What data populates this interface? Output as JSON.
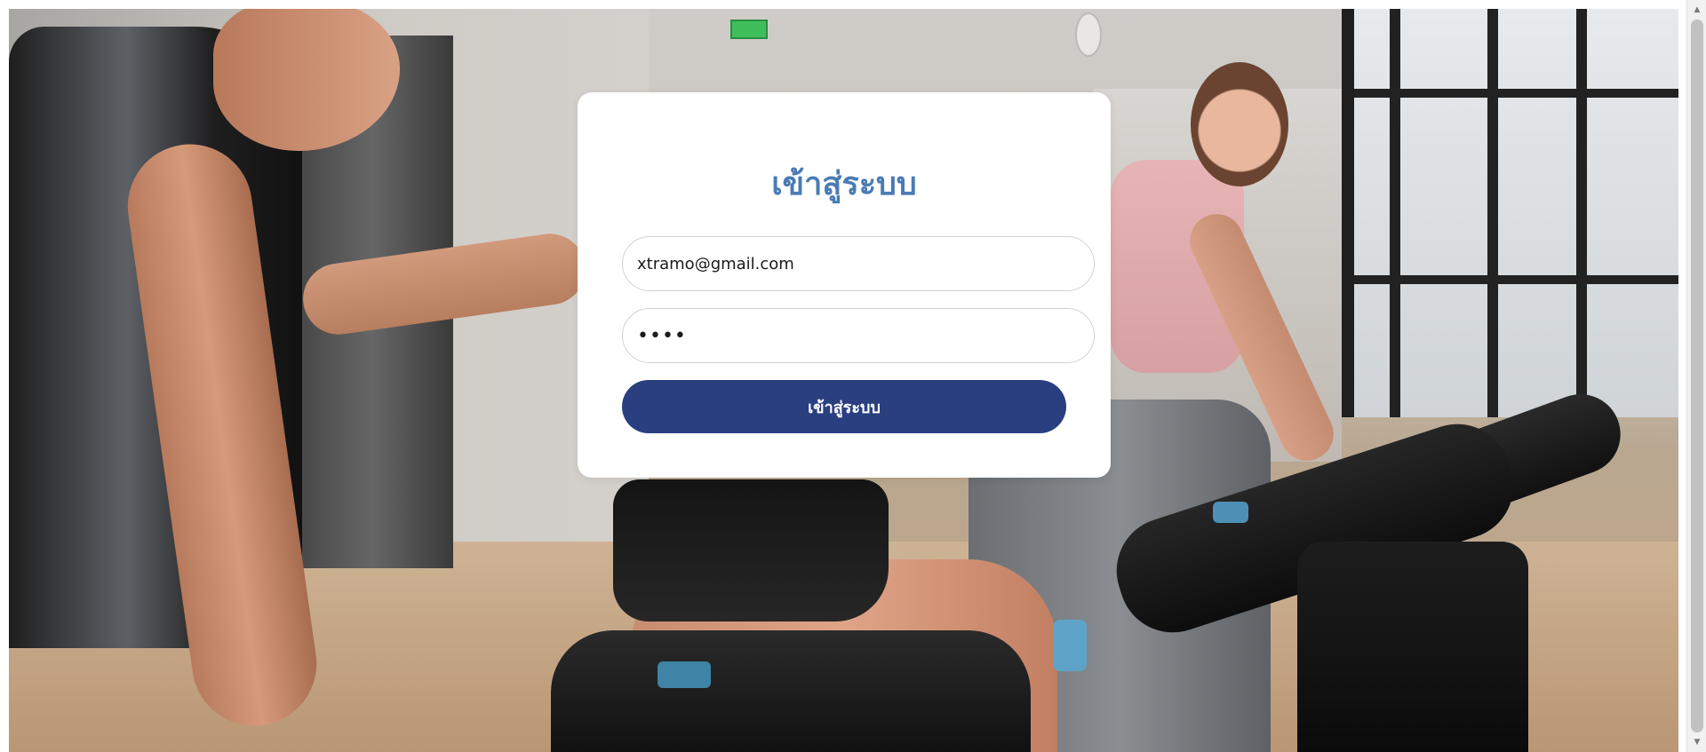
{
  "login": {
    "title": "เข้าสู่ระบบ",
    "email_value": "xtramo@gmail.com",
    "password_value": "••••",
    "submit_label": "เข้าสู่ระบบ"
  },
  "background": {
    "scene": "gym-spin-class-photo"
  },
  "scrollbar": {
    "up_arrow": "▲",
    "down_arrow": "▼"
  },
  "colors": {
    "title": "#4a7bb4",
    "button": "#2a3f80",
    "card": "#ffffff"
  }
}
